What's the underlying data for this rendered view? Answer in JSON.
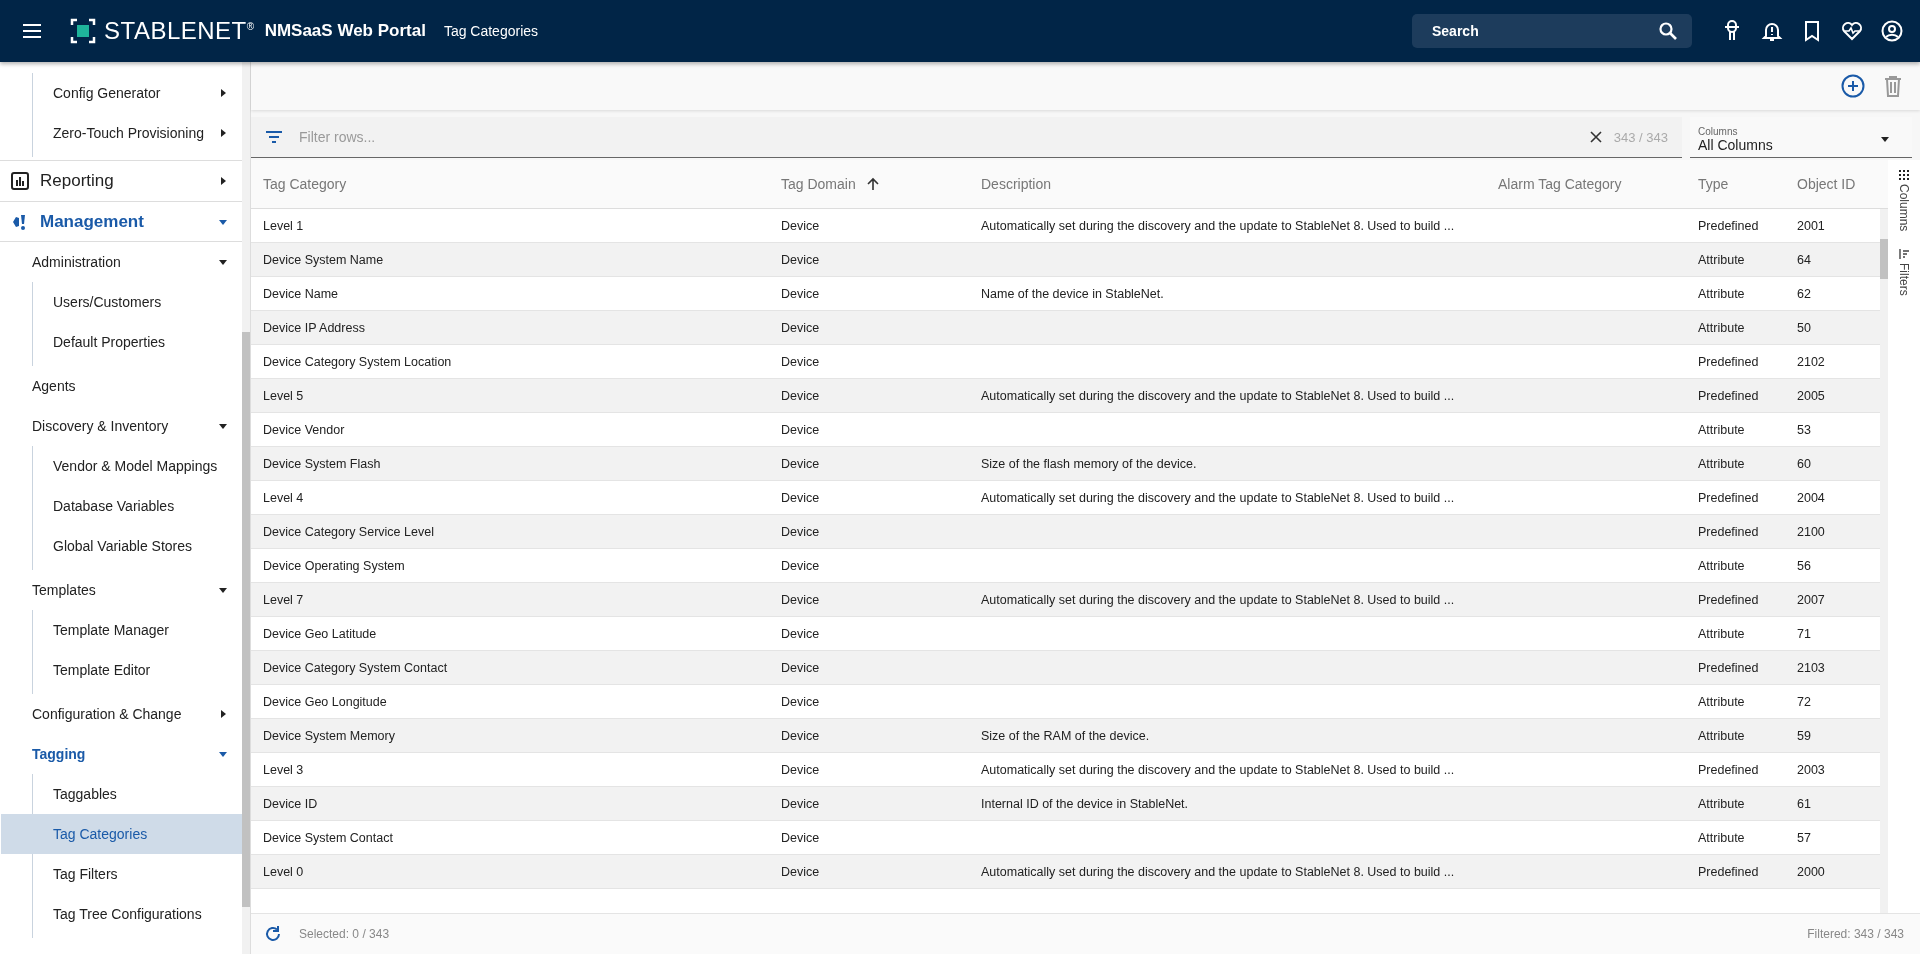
{
  "header": {
    "brand": "STABLENET$^{®}$",
    "product": "NMSaaS Web Portal",
    "page_title": "Tag Categories",
    "search": {
      "placeholder": "Search"
    }
  },
  "sidebar": {
    "continued_items": [
      {
        "label": "Config Generator",
        "expanded": false
      },
      {
        "label": "Zero-Touch Provisioning",
        "expanded": false
      }
    ],
    "sections": [
      {
        "label": "Reporting",
        "expanded": false
      },
      {
        "label": "Management",
        "expanded": true,
        "children": [
          {
            "label": "Administration",
            "expanded": true,
            "children": [
              {
                "label": "Users/Customers",
                "selected": false
              },
              {
                "label": "Default Properties",
                "selected": false
              }
            ]
          },
          {
            "label": "Agents",
            "selected": false
          },
          {
            "label": "Discovery & Inventory",
            "expanded": true,
            "children": [
              {
                "label": "Vendor & Model Mappings",
                "selected": false
              },
              {
                "label": "Database Variables",
                "selected": false
              },
              {
                "label": "Global Variable Stores",
                "selected": false
              }
            ]
          },
          {
            "label": "Templates",
            "expanded": true,
            "children": [
              {
                "label": "Template Manager",
                "selected": false
              },
              {
                "label": "Template Editor",
                "selected": false
              }
            ]
          },
          {
            "label": "Configuration & Change",
            "expanded": false
          },
          {
            "label": "Tagging",
            "expanded": true,
            "children": [
              {
                "label": "Taggables",
                "selected": false
              },
              {
                "label": "Tag Categories",
                "selected": true
              },
              {
                "label": "Tag Filters",
                "selected": false
              },
              {
                "label": "Tag Tree Configurations",
                "selected": false
              }
            ]
          }
        ]
      }
    ]
  },
  "filter": {
    "placeholder": "Filter rows...",
    "count": "343 / 343"
  },
  "columns_select": {
    "label": "Columns",
    "value": "All Columns"
  },
  "table": {
    "columns": [
      {
        "label": "Tag Category",
        "sorted": false
      },
      {
        "label": "Tag Domain",
        "sorted": true
      },
      {
        "label": "Description",
        "sorted": false
      },
      {
        "label": "Alarm Tag Category",
        "sorted": false
      },
      {
        "label": "Type",
        "sorted": false
      },
      {
        "label": "Object ID",
        "sorted": false
      }
    ],
    "rows": [
      {
        "tag_category": "Level 1",
        "tag_domain": "Device",
        "description": "Automatically set during the discovery and the update to StableNet 8. Used to build ...",
        "type": "Predefined",
        "object_id": "2001"
      },
      {
        "tag_category": "Device System Name",
        "tag_domain": "Device",
        "type": "Attribute",
        "object_id": "64"
      },
      {
        "tag_category": "Device Name",
        "tag_domain": "Device",
        "description": "Name of the device in StableNet.",
        "type": "Attribute",
        "object_id": "62"
      },
      {
        "tag_category": "Device IP Address",
        "tag_domain": "Device",
        "type": "Attribute",
        "object_id": "50"
      },
      {
        "tag_category": "Device Category System Location",
        "tag_domain": "Device",
        "type": "Predefined",
        "object_id": "2102"
      },
      {
        "tag_category": "Level 5",
        "tag_domain": "Device",
        "description": "Automatically set during the discovery and the update to StableNet 8. Used to build ...",
        "type": "Predefined",
        "object_id": "2005"
      },
      {
        "tag_category": "Device Vendor",
        "tag_domain": "Device",
        "type": "Attribute",
        "object_id": "53"
      },
      {
        "tag_category": "Device System Flash",
        "tag_domain": "Device",
        "description": "Size of the flash memory of the device.",
        "type": "Attribute",
        "object_id": "60"
      },
      {
        "tag_category": "Level 4",
        "tag_domain": "Device",
        "description": "Automatically set during the discovery and the update to StableNet 8. Used to build ...",
        "type": "Predefined",
        "object_id": "2004"
      },
      {
        "tag_category": "Device Category Service Level",
        "tag_domain": "Device",
        "type": "Predefined",
        "object_id": "2100"
      },
      {
        "tag_category": "Device Operating System",
        "tag_domain": "Device",
        "type": "Attribute",
        "object_id": "56"
      },
      {
        "tag_category": "Level 7",
        "tag_domain": "Device",
        "description": "Automatically set during the discovery and the update to StableNet 8. Used to build ...",
        "type": "Predefined",
        "object_id": "2007"
      },
      {
        "tag_category": "Device Geo Latitude",
        "tag_domain": "Device",
        "type": "Attribute",
        "object_id": "71"
      },
      {
        "tag_category": "Device Category System Contact",
        "tag_domain": "Device",
        "type": "Predefined",
        "object_id": "2103"
      },
      {
        "tag_category": "Device Geo Longitude",
        "tag_domain": "Device",
        "type": "Attribute",
        "object_id": "72"
      },
      {
        "tag_category": "Device System Memory",
        "tag_domain": "Device",
        "description": "Size of the RAM of the device.",
        "type": "Attribute",
        "object_id": "59"
      },
      {
        "tag_category": "Level 3",
        "tag_domain": "Device",
        "description": "Automatically set during the discovery and the update to StableNet 8. Used to build ...",
        "type": "Predefined",
        "object_id": "2003"
      },
      {
        "tag_category": "Device ID",
        "tag_domain": "Device",
        "description": "Internal ID of the device in StableNet.",
        "type": "Attribute",
        "object_id": "61"
      },
      {
        "tag_category": "Device System Contact",
        "tag_domain": "Device",
        "type": "Attribute",
        "object_id": "57"
      },
      {
        "tag_category": "Level 0",
        "tag_domain": "Device",
        "description": "Automatically set during the discovery and the update to StableNet 8. Used to build ...",
        "type": "Predefined",
        "object_id": "2000"
      }
    ]
  },
  "side_tabs": [
    "Columns",
    "Filters"
  ],
  "footer": {
    "selected": "Selected: 0 / 343",
    "filtered": "Filtered: 343 / 343"
  }
}
